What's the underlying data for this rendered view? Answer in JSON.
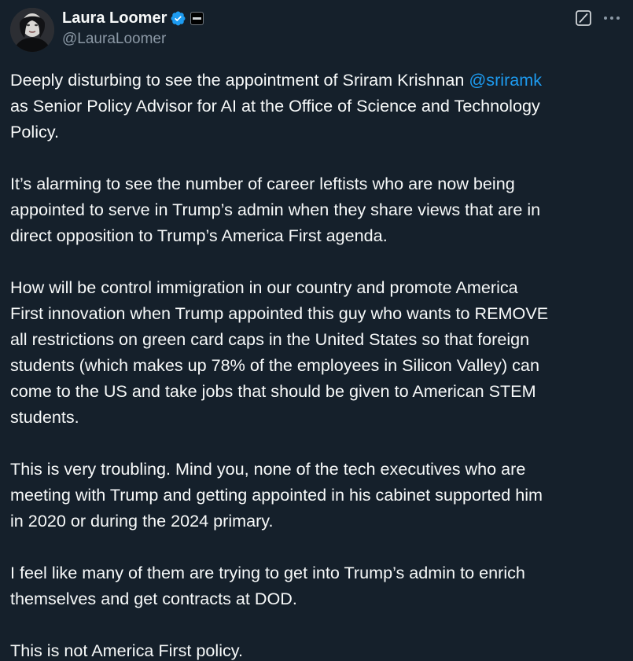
{
  "author": {
    "display_name": "Laura Loomer",
    "handle": "@LauraLoomer",
    "verified": true,
    "affiliate_badge_icon": "affiliate-badge-icon",
    "avatar_icon": "profile-photo"
  },
  "header_actions": {
    "grok_icon": "grok-icon",
    "more_icon": "more-options-icon"
  },
  "post": {
    "p1_before": "Deeply disturbing to see the appointment of Sriram Krishnan ",
    "p1_mention": "@sriramk",
    "p1_after": "\nas Senior Policy Advisor for AI at the Office of Science and Technology\nPolicy.",
    "p2": "It’s alarming to see the number of career leftists who are now being\nappointed to serve in Trump’s admin when they share views that are in\ndirect opposition to Trump’s America First agenda.",
    "p3": "How will be control immigration in our country and promote America\nFirst innovation when Trump appointed this guy who wants to REMOVE\nall restrictions on green card caps in the United States so that foreign\nstudents (which makes up 78% of the employees in Silicon Valley) can\ncome to the US and take jobs that should be given to American STEM\nstudents.",
    "p4": "This is very troubling. Mind you, none of the tech executives who are\nmeeting with Trump and getting appointed in his cabinet supported him\nin 2020 or during the 2024 primary.",
    "p5": "I feel like many of them are trying to get into Trump’s admin to enrich\nthemselves and get contracts at DOD.",
    "p6": "This is not America First policy."
  },
  "colors": {
    "background": "#15202b",
    "text": "#f7f9f9",
    "secondary_text": "#8b98a5",
    "link": "#1d9bf0"
  }
}
